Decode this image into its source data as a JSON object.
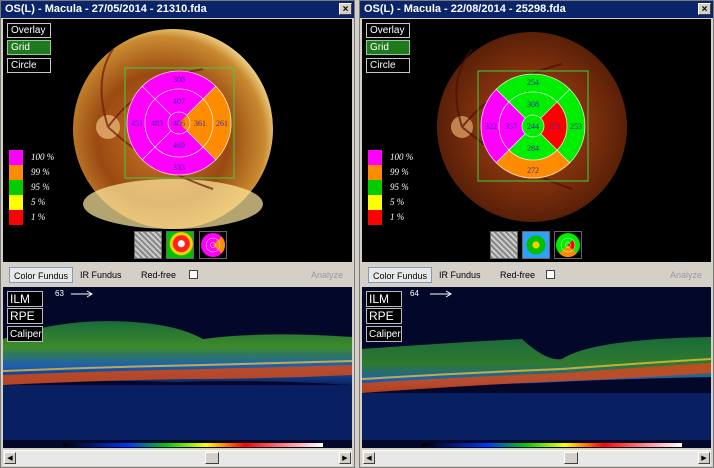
{
  "colors": {
    "title_bg": "#0a246a",
    "magenta": "#ff00ff",
    "green": "#00ee00",
    "orange": "#ff8c00",
    "grid_box": "#3cd03c"
  },
  "legend": [
    {
      "label": "100 %",
      "color": "#ff00ff"
    },
    {
      "label": "99 %",
      "color": "#ff8c00"
    },
    {
      "label": "95 %",
      "color": "#00cc00"
    },
    {
      "label": "5 %",
      "color": "#ffff00"
    },
    {
      "label": "1 %",
      "color": "#ff0000"
    }
  ],
  "buttons": {
    "overlay": "Overlay",
    "grid": "Grid",
    "circle": "Circle"
  },
  "tabs": {
    "color_fundus": "Color Fundus",
    "ir_fundus": "IR Fundus",
    "red_free": "Red-free",
    "analyze": "Analyze"
  },
  "oct_buttons": {
    "ilm": "ILM",
    "rpe": "RPE",
    "caliper": "Caliper"
  },
  "panels": [
    {
      "title": "OS(L) - Macula - 27/05/2014 - 21310.fda",
      "close": "×",
      "scan_number": "63",
      "grid": {
        "outer_top": "308",
        "inner_top": "407",
        "center": "406",
        "inner_left": "483",
        "inner_right": "361",
        "outer_left": "451",
        "outer_right": "261",
        "inner_bottom": "469",
        "outer_bottom": "333"
      }
    },
    {
      "title": "OS(L) - Macula - 22/08/2014 - 25298.fda",
      "close": "×",
      "scan_number": "64",
      "grid": {
        "outer_top": "254",
        "inner_top": "308",
        "center": "244",
        "inner_left": "357",
        "inner_right": "253",
        "outer_left": "322",
        "outer_right": "253",
        "inner_bottom": "284",
        "outer_bottom": "272"
      }
    }
  ]
}
